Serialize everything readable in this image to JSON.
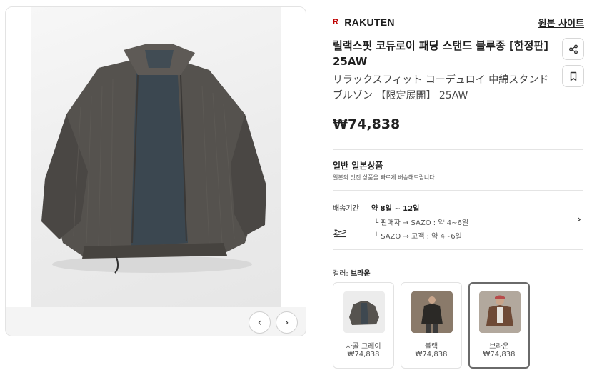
{
  "store": {
    "logo": "R",
    "name": "RAKUTEN",
    "original_link": "원본 사이트"
  },
  "product": {
    "title_ko": "릴랙스핏 코듀로이 패딩 스탠드 블루종 [한정판] 25AW",
    "title_ja": "リラックスフィット コーデュロイ 中綿スタンドブルゾン 【限定展開】 25AW",
    "price": "₩74,838"
  },
  "info": {
    "title": "일반 일본상품",
    "subtitle": "일본의 멋진 상품을 빠르게 배송해드립니다."
  },
  "shipping": {
    "label": "배송기간",
    "main": "약 8일 ~ 12일",
    "leg1": "└ 판매자 → SAZO : 약 4~6일",
    "leg2": "└ SAZO → 고객 : 약 4~6일"
  },
  "color": {
    "label": "컬러: ",
    "selected": "브라운",
    "options": [
      {
        "name": "차콜 그레이",
        "price": "₩74,838"
      },
      {
        "name": "블랙",
        "price": "₩74,838"
      },
      {
        "name": "브라운",
        "price": "₩74,838"
      }
    ]
  },
  "gallery": {
    "prev": "‹",
    "next": "›"
  },
  "icons": [
    "share-icon",
    "bookmark-icon",
    "airplane-icon",
    "chevron-right-icon",
    "chevron-left-icon"
  ],
  "colors": {
    "brand_red": "#bf0000",
    "jacket": "#4e4c49",
    "lining": "#3b4750"
  }
}
